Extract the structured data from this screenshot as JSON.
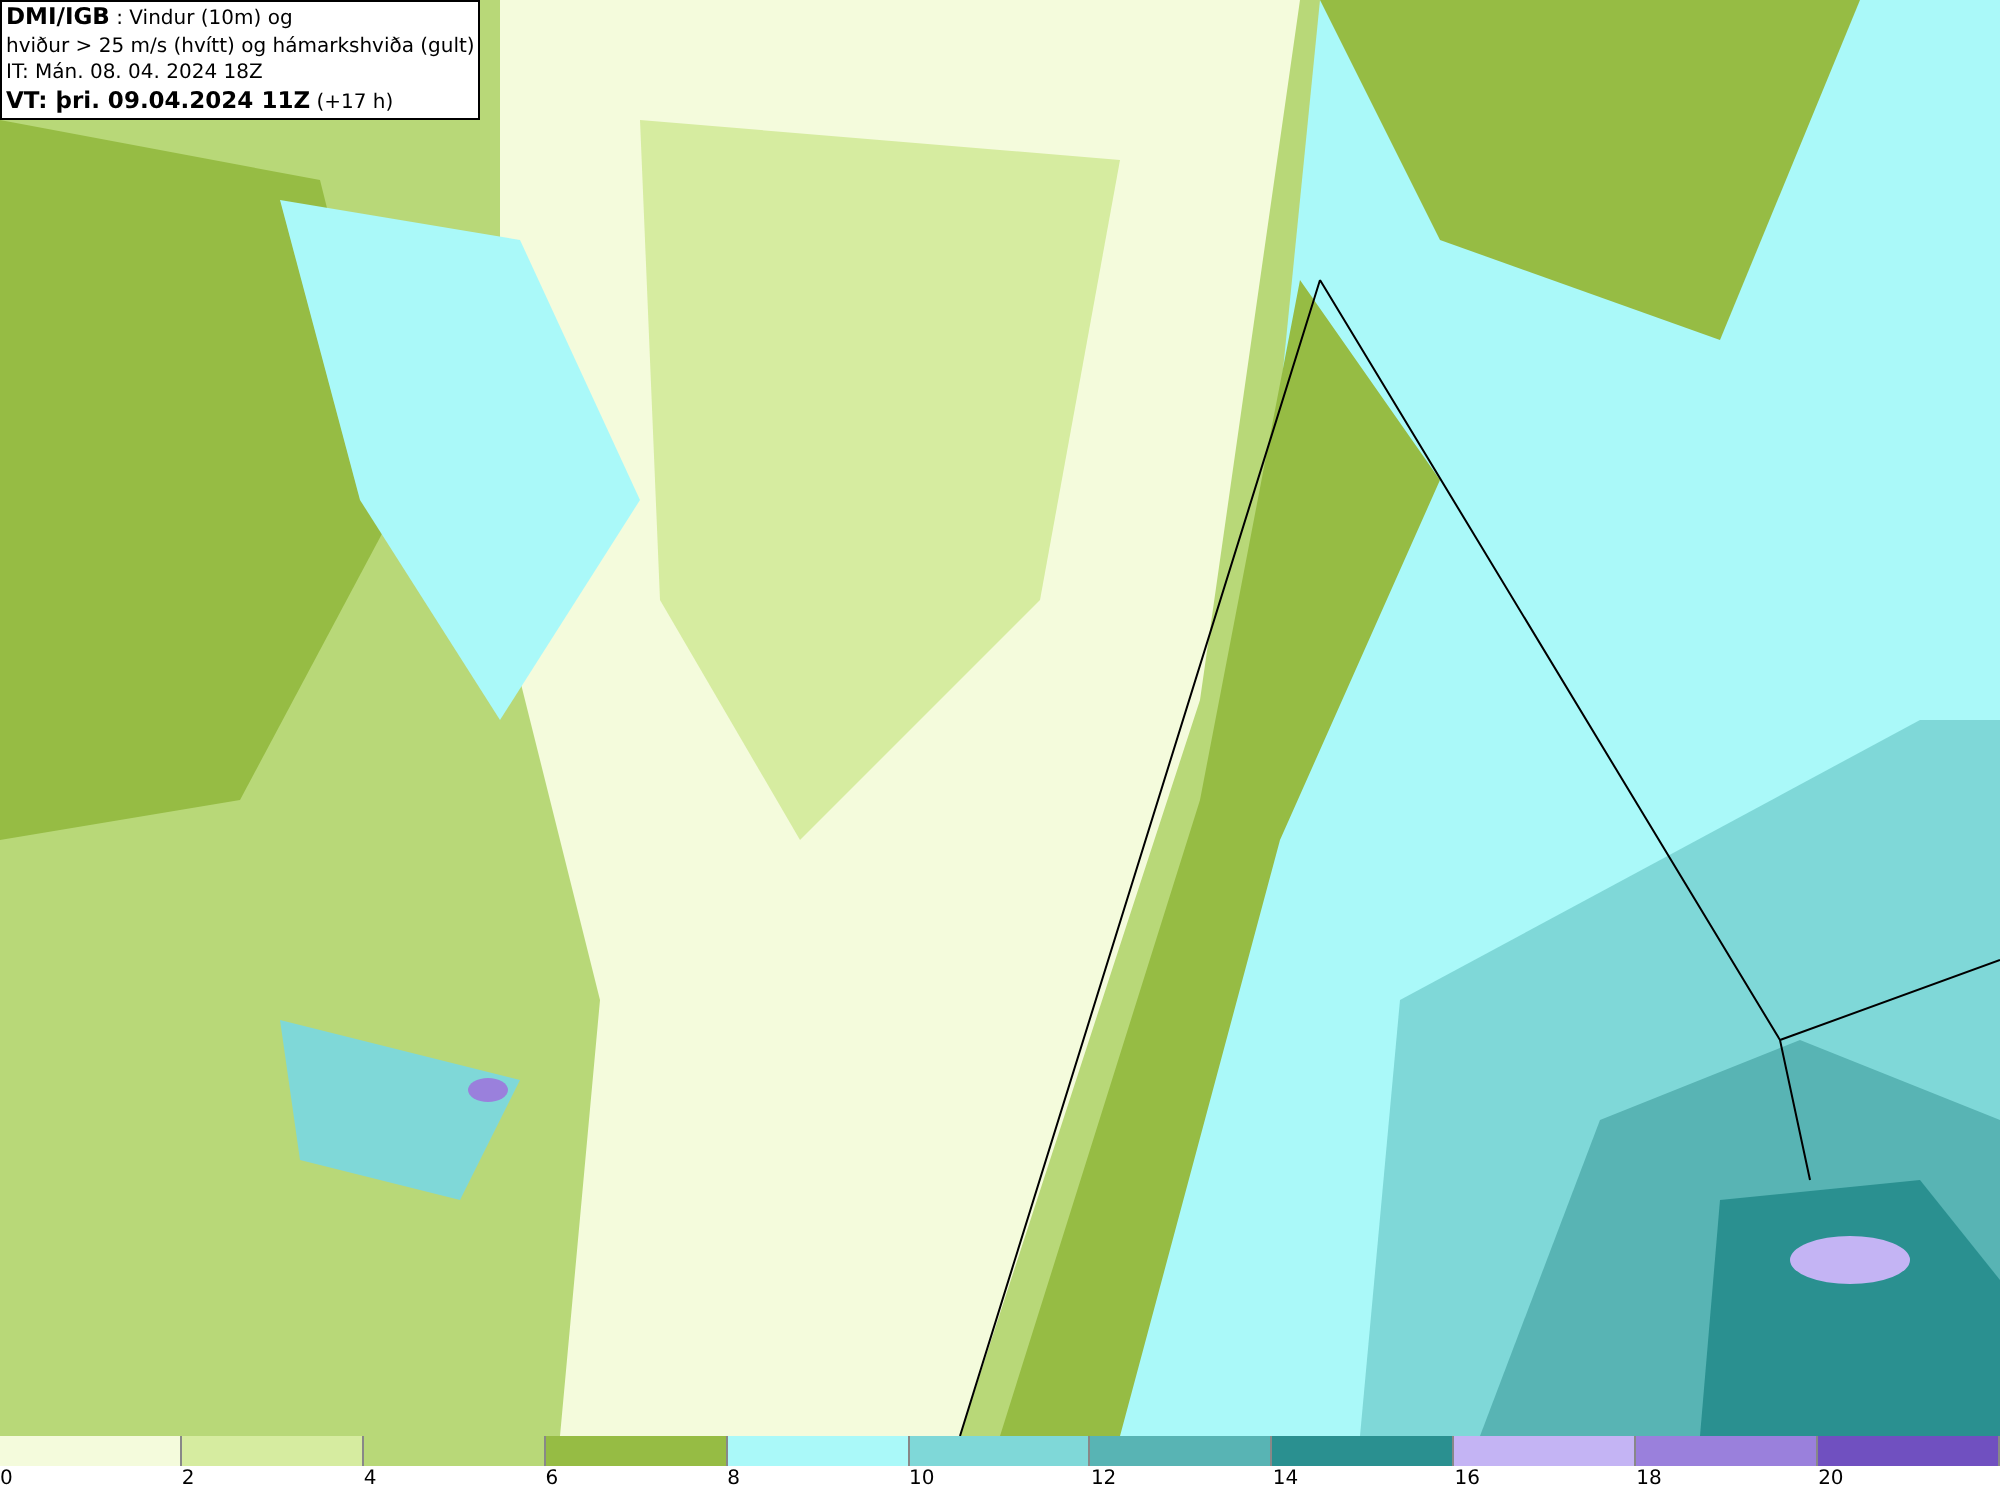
{
  "title_box": {
    "lines": [
      "**DMI/IGB** : Vindur (10m) og",
      "hviður > 25 m/s (hvítt) og hámarkshviða (gult)",
      "IT: Mán. 08. 04. 2024 18Z",
      "**VT: þri. 09.04.2024 11Z** (+17 h)"
    ]
  },
  "legend": {
    "bins": [
      {
        "label": "0",
        "color": "#f4fbdc"
      },
      {
        "label": "2",
        "color": "#d6eca0"
      },
      {
        "label": "4",
        "color": "#b8d878"
      },
      {
        "label": "6",
        "color": "#96bc44"
      },
      {
        "label": "8",
        "color": "#aaf9f9"
      },
      {
        "label": "10",
        "color": "#7fd8d8"
      },
      {
        "label": "12",
        "color": "#58b4b4"
      },
      {
        "label": "14",
        "color": "#2a9090"
      },
      {
        "label": "16",
        "color": "#c4b4f4"
      },
      {
        "label": "18",
        "color": "#9a80dc"
      },
      {
        "label": "20",
        "color": "#7050c0"
      }
    ]
  }
}
